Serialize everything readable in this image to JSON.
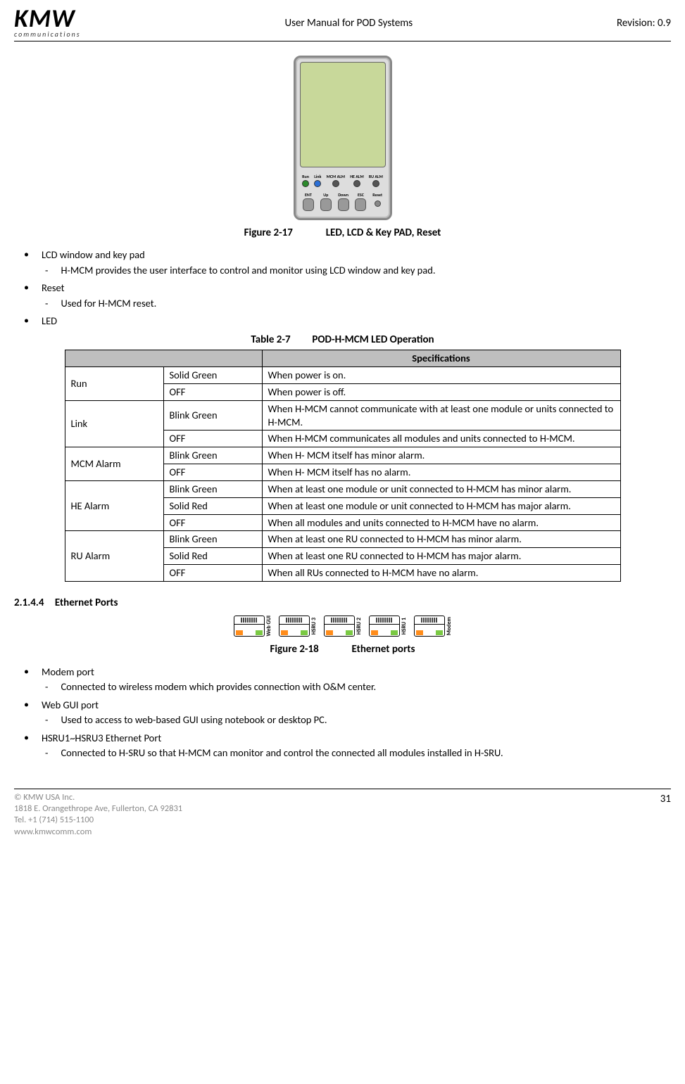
{
  "header": {
    "logo_main": "KMW",
    "logo_sub": "communications",
    "title": "User Manual for POD Systems",
    "revision": "Revision: 0.9"
  },
  "figure17": {
    "num": "Figure 2-17",
    "title": "LED, LCD & Key PAD, Reset",
    "leds": [
      {
        "label": "Run",
        "color": "green"
      },
      {
        "label": "Link",
        "color": "blue"
      },
      {
        "label": "MCM\nALM",
        "color": "off"
      },
      {
        "label": "HE\nALM",
        "color": "off"
      },
      {
        "label": "RU\nALM",
        "color": "off"
      }
    ],
    "buttons": [
      {
        "label": "ENT"
      },
      {
        "label": "Up"
      },
      {
        "label": "Down"
      },
      {
        "label": "ESC"
      }
    ],
    "reset_label": "Reset"
  },
  "bullets1": [
    {
      "text": "LCD window and key pad",
      "sub": [
        "H-MCM provides the user interface to control and monitor using LCD window and key pad."
      ]
    },
    {
      "text": "Reset",
      "sub": [
        "Used for H-MCM reset."
      ]
    },
    {
      "text": "LED",
      "sub": []
    }
  ],
  "table27": {
    "num": "Table 2-7",
    "title": "POD-H-MCM LED Operation",
    "header_spec": "Specifications",
    "groups": [
      {
        "name": "Run",
        "rows": [
          {
            "state": "Solid Green",
            "spec": "When power is on."
          },
          {
            "state": "OFF",
            "spec": "When power is off."
          }
        ]
      },
      {
        "name": "Link",
        "rows": [
          {
            "state": "Blink Green",
            "spec": "When H-MCM cannot communicate with at least one module or units connected to H-MCM."
          },
          {
            "state": "OFF",
            "spec": "When H-MCM communicates all modules and units connected to H-MCM."
          }
        ]
      },
      {
        "name": "MCM Alarm",
        "rows": [
          {
            "state": "Blink Green",
            "spec": "When H- MCM itself has minor alarm."
          },
          {
            "state": "OFF",
            "spec": "When H- MCM itself has no alarm."
          }
        ]
      },
      {
        "name": "HE Alarm",
        "rows": [
          {
            "state": "Blink Green",
            "spec": "When at least one module or unit connected to H-MCM has minor alarm."
          },
          {
            "state": "Solid Red",
            "spec": "When at least one module or unit connected to H-MCM has major alarm."
          },
          {
            "state": "OFF",
            "spec": "When all modules and units connected to H-MCM have no alarm."
          }
        ]
      },
      {
        "name": "RU Alarm",
        "rows": [
          {
            "state": "Blink Green",
            "spec": "When at least one RU connected to H-MCM has minor alarm."
          },
          {
            "state": "Solid Red",
            "spec": "When at least one RU connected to H-MCM has major alarm."
          },
          {
            "state": "OFF",
            "spec": "When all RUs connected to H-MCM have no alarm."
          }
        ]
      }
    ]
  },
  "section2144": {
    "num": "2.1.4.4",
    "title": "Ethernet Ports"
  },
  "figure18": {
    "num": "Figure 2-18",
    "title": "Ethernet ports",
    "ports": [
      "Web GUI",
      "HSRU 3",
      "HSRU 2",
      "HSRU 1",
      "Modem"
    ]
  },
  "bullets2": [
    {
      "text": "Modem port",
      "sub": [
        "Connected to wireless modem which provides connection with O&M center."
      ]
    },
    {
      "text": "Web GUI port",
      "sub": [
        "Used to access to web-based GUI using notebook or desktop PC."
      ]
    },
    {
      "text": "HSRU1~HSRU3 Ethernet Port",
      "sub": [
        "Connected to H-SRU so that H-MCM can monitor and control the connected all modules installed in H-SRU."
      ]
    }
  ],
  "footer": {
    "copyright": "© KMW USA Inc.",
    "address": "1818 E. Orangethrope Ave, Fullerton, CA 92831",
    "tel": "Tel. +1 (714) 515-1100",
    "web": "www.kmwcomm.com",
    "page": "31"
  }
}
